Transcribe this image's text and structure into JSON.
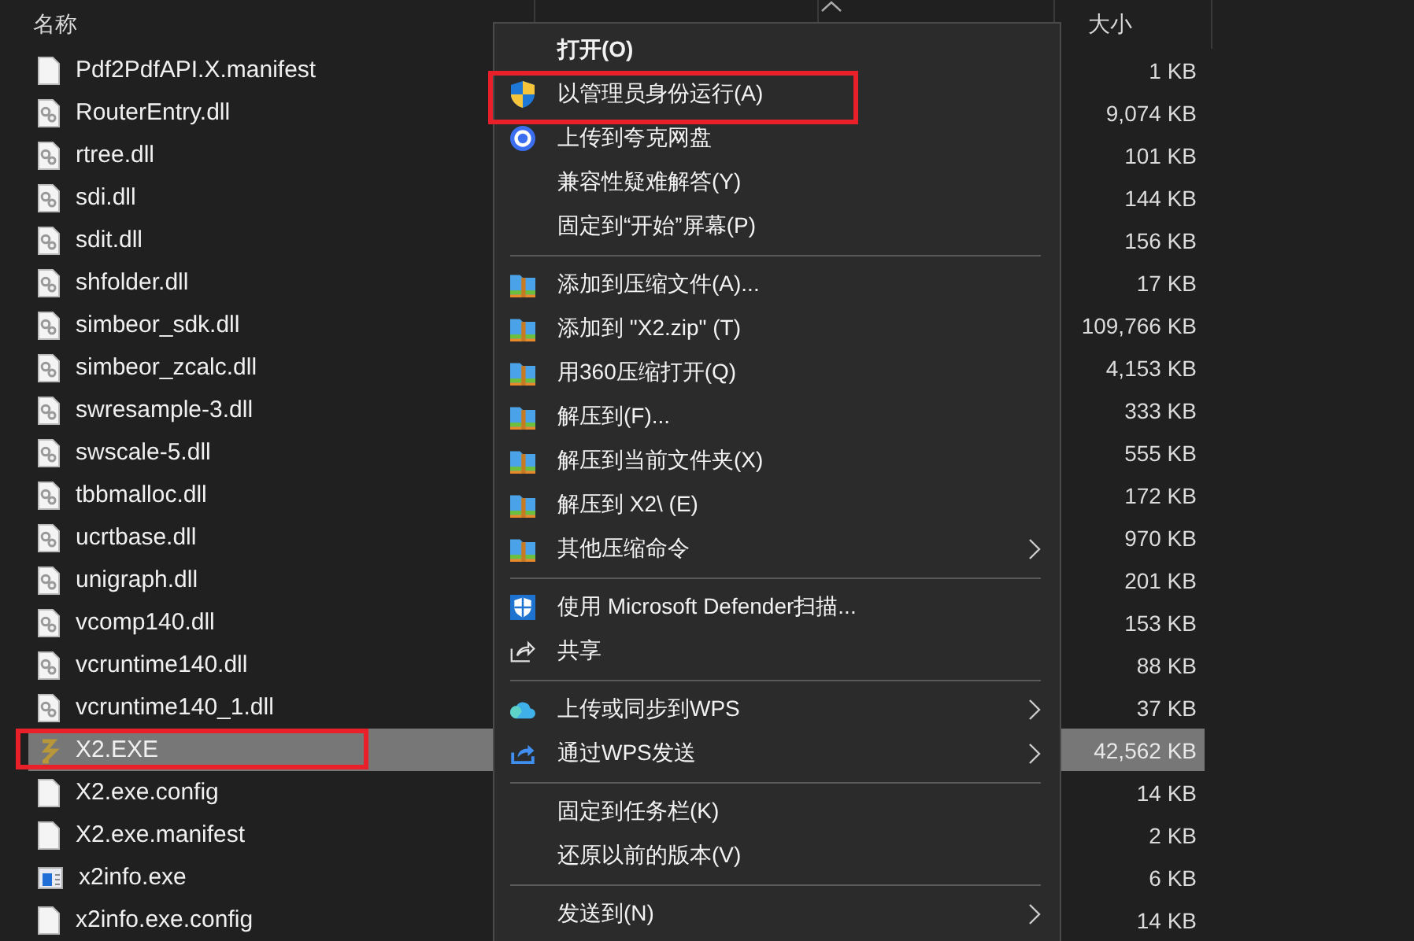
{
  "columns": {
    "name": "名称",
    "size": "大小"
  },
  "files": [
    {
      "name": "Pdf2PdfAPI.X.manifest",
      "size": "1 KB",
      "kind": "blank",
      "selected": false,
      "highlight": false
    },
    {
      "name": "RouterEntry.dll",
      "size": "9,074 KB",
      "kind": "dll",
      "selected": false,
      "highlight": false
    },
    {
      "name": "rtree.dll",
      "size": "101 KB",
      "kind": "dll",
      "selected": false,
      "highlight": false
    },
    {
      "name": "sdi.dll",
      "size": "144 KB",
      "kind": "dll",
      "selected": false,
      "highlight": false
    },
    {
      "name": "sdit.dll",
      "size": "156 KB",
      "kind": "dll",
      "selected": false,
      "highlight": false
    },
    {
      "name": "shfolder.dll",
      "size": "17 KB",
      "kind": "dll",
      "selected": false,
      "highlight": false
    },
    {
      "name": "simbeor_sdk.dll",
      "size": "109,766 KB",
      "kind": "dll",
      "selected": false,
      "highlight": false
    },
    {
      "name": "simbeor_zcalc.dll",
      "size": "4,153 KB",
      "kind": "dll",
      "selected": false,
      "highlight": false
    },
    {
      "name": "swresample-3.dll",
      "size": "333 KB",
      "kind": "dll",
      "selected": false,
      "highlight": false
    },
    {
      "name": "swscale-5.dll",
      "size": "555 KB",
      "kind": "dll",
      "selected": false,
      "highlight": false
    },
    {
      "name": "tbbmalloc.dll",
      "size": "172 KB",
      "kind": "dll",
      "selected": false,
      "highlight": false
    },
    {
      "name": "ucrtbase.dll",
      "size": "970 KB",
      "kind": "dll",
      "selected": false,
      "highlight": false
    },
    {
      "name": "unigraph.dll",
      "size": "201 KB",
      "kind": "dll",
      "selected": false,
      "highlight": false
    },
    {
      "name": "vcomp140.dll",
      "size": "153 KB",
      "kind": "dll",
      "selected": false,
      "highlight": false
    },
    {
      "name": "vcruntime140.dll",
      "size": "88 KB",
      "kind": "dll",
      "selected": false,
      "highlight": false
    },
    {
      "name": "vcruntime140_1.dll",
      "size": "37 KB",
      "kind": "dll",
      "selected": false,
      "highlight": false
    },
    {
      "name": "X2.EXE",
      "size": "42,562 KB",
      "kind": "app",
      "selected": true,
      "highlight": true
    },
    {
      "name": "X2.exe.config",
      "size": "14 KB",
      "kind": "blank",
      "selected": false,
      "highlight": false
    },
    {
      "name": "X2.exe.manifest",
      "size": "2 KB",
      "kind": "blank",
      "selected": false,
      "highlight": false
    },
    {
      "name": "x2info.exe",
      "size": "6 KB",
      "kind": "window",
      "selected": false,
      "highlight": false
    },
    {
      "name": "x2info.exe.config",
      "size": "14 KB",
      "kind": "blank",
      "selected": false,
      "highlight": false
    }
  ],
  "context_menu": [
    {
      "kind": "plain",
      "label": "打开(O)",
      "default": true,
      "submenu": false,
      "highlight": false
    },
    {
      "kind": "shield",
      "label": "以管理员身份运行(A)",
      "default": false,
      "submenu": false,
      "highlight": true
    },
    {
      "kind": "ring",
      "label": "上传到夸克网盘",
      "default": false,
      "submenu": false,
      "highlight": false
    },
    {
      "kind": "plain",
      "label": "兼容性疑难解答(Y)",
      "default": false,
      "submenu": false,
      "highlight": false
    },
    {
      "kind": "plain",
      "label": "固定到“开始”屏幕(P)",
      "default": false,
      "submenu": false,
      "highlight": false
    },
    {
      "kind": "separator"
    },
    {
      "kind": "archive",
      "label": "添加到压缩文件(A)...",
      "default": false,
      "submenu": false,
      "highlight": false
    },
    {
      "kind": "archive",
      "label": "添加到 \"X2.zip\" (T)",
      "default": false,
      "submenu": false,
      "highlight": false
    },
    {
      "kind": "archive",
      "label": "用360压缩打开(Q)",
      "default": false,
      "submenu": false,
      "highlight": false
    },
    {
      "kind": "archive",
      "label": "解压到(F)...",
      "default": false,
      "submenu": false,
      "highlight": false
    },
    {
      "kind": "archive",
      "label": "解压到当前文件夹(X)",
      "default": false,
      "submenu": false,
      "highlight": false
    },
    {
      "kind": "archive",
      "label": "解压到 X2\\ (E)",
      "default": false,
      "submenu": false,
      "highlight": false
    },
    {
      "kind": "archive",
      "label": "其他压缩命令",
      "default": false,
      "submenu": true,
      "highlight": false
    },
    {
      "kind": "separator"
    },
    {
      "kind": "defender",
      "label": "使用 Microsoft Defender扫描...",
      "default": false,
      "submenu": false,
      "highlight": false
    },
    {
      "kind": "share",
      "label": "共享",
      "default": false,
      "submenu": false,
      "highlight": false
    },
    {
      "kind": "separator"
    },
    {
      "kind": "cloud",
      "label": "上传或同步到WPS",
      "default": false,
      "submenu": true,
      "highlight": false
    },
    {
      "kind": "send",
      "label": "通过WPS发送",
      "default": false,
      "submenu": true,
      "highlight": false
    },
    {
      "kind": "separator"
    },
    {
      "kind": "plain",
      "label": "固定到任务栏(K)",
      "default": false,
      "submenu": false,
      "highlight": false
    },
    {
      "kind": "plain",
      "label": "还原以前的版本(V)",
      "default": false,
      "submenu": false,
      "highlight": false
    },
    {
      "kind": "separator"
    },
    {
      "kind": "plain",
      "label": "发送到(N)",
      "default": false,
      "submenu": true,
      "highlight": false
    }
  ]
}
